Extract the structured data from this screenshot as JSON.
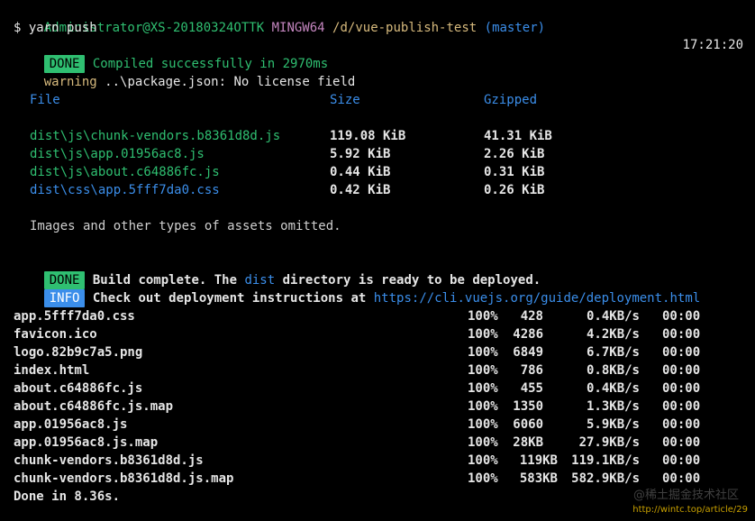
{
  "prompt": {
    "user_host": "Administrator@XS-20180324OTTK",
    "shell": "MINGW64",
    "path": "/d/vue-publish-test",
    "branch": "(master)",
    "command": "$ yarn push"
  },
  "compile": {
    "badge": "DONE",
    "message": "Compiled successfully in 2970ms",
    "time": "17:21:20"
  },
  "warning": {
    "label": "warning",
    "message": "..\\package.json: No license field"
  },
  "assets_table": {
    "headers": [
      "File",
      "Size",
      "Gzipped"
    ],
    "rows": [
      {
        "file": "dist\\js\\chunk-vendors.b8361d8d.js",
        "size": "119.08 KiB",
        "gzip": "41.31 KiB",
        "color": "#2fbf71"
      },
      {
        "file": "dist\\js\\app.01956ac8.js",
        "size": "5.92 KiB",
        "gzip": "2.26 KiB",
        "color": "#2fbf71"
      },
      {
        "file": "dist\\js\\about.c64886fc.js",
        "size": "0.44 KiB",
        "gzip": "0.31 KiB",
        "color": "#2fbf71"
      },
      {
        "file": "dist\\css\\app.5fff7da0.css",
        "size": "0.42 KiB",
        "gzip": "0.26 KiB",
        "color": "#3b8eea"
      }
    ],
    "note": "Images and other types of assets omitted."
  },
  "build": {
    "badge": "DONE",
    "pre": "Build complete. The ",
    "dir": "dist",
    "post": " directory is ready to be deployed."
  },
  "info": {
    "badge": "INFO",
    "pre": "Check out deployment instructions at ",
    "url": "https://cli.vuejs.org/guide/deployment.html"
  },
  "uploads": [
    {
      "name": "app.5fff7da0.css",
      "pct": "100%",
      "size": "428",
      "speed": "0.4KB/s",
      "eta": "00:00"
    },
    {
      "name": "favicon.ico",
      "pct": "100%",
      "size": "4286",
      "speed": "4.2KB/s",
      "eta": "00:00"
    },
    {
      "name": "logo.82b9c7a5.png",
      "pct": "100%",
      "size": "6849",
      "speed": "6.7KB/s",
      "eta": "00:00"
    },
    {
      "name": "index.html",
      "pct": "100%",
      "size": "786",
      "speed": "0.8KB/s",
      "eta": "00:00"
    },
    {
      "name": "about.c64886fc.js",
      "pct": "100%",
      "size": "455",
      "speed": "0.4KB/s",
      "eta": "00:00"
    },
    {
      "name": "about.c64886fc.js.map",
      "pct": "100%",
      "size": "1350",
      "speed": "1.3KB/s",
      "eta": "00:00"
    },
    {
      "name": "app.01956ac8.js",
      "pct": "100%",
      "size": "6060",
      "speed": "5.9KB/s",
      "eta": "00:00"
    },
    {
      "name": "app.01956ac8.js.map",
      "pct": "100%",
      "size": "28KB",
      "speed": "27.9KB/s",
      "eta": "00:00"
    },
    {
      "name": "chunk-vendors.b8361d8d.js",
      "pct": "100%",
      "size": "119KB",
      "speed": "119.1KB/s",
      "eta": "00:00"
    },
    {
      "name": "chunk-vendors.b8361d8d.js.map",
      "pct": "100%",
      "size": "583KB",
      "speed": "582.9KB/s",
      "eta": "00:00"
    }
  ],
  "done": "Done in 8.36s.",
  "watermark": {
    "site": "@稀土掘金技术社区",
    "url": "http://wintc.top/article/29"
  }
}
